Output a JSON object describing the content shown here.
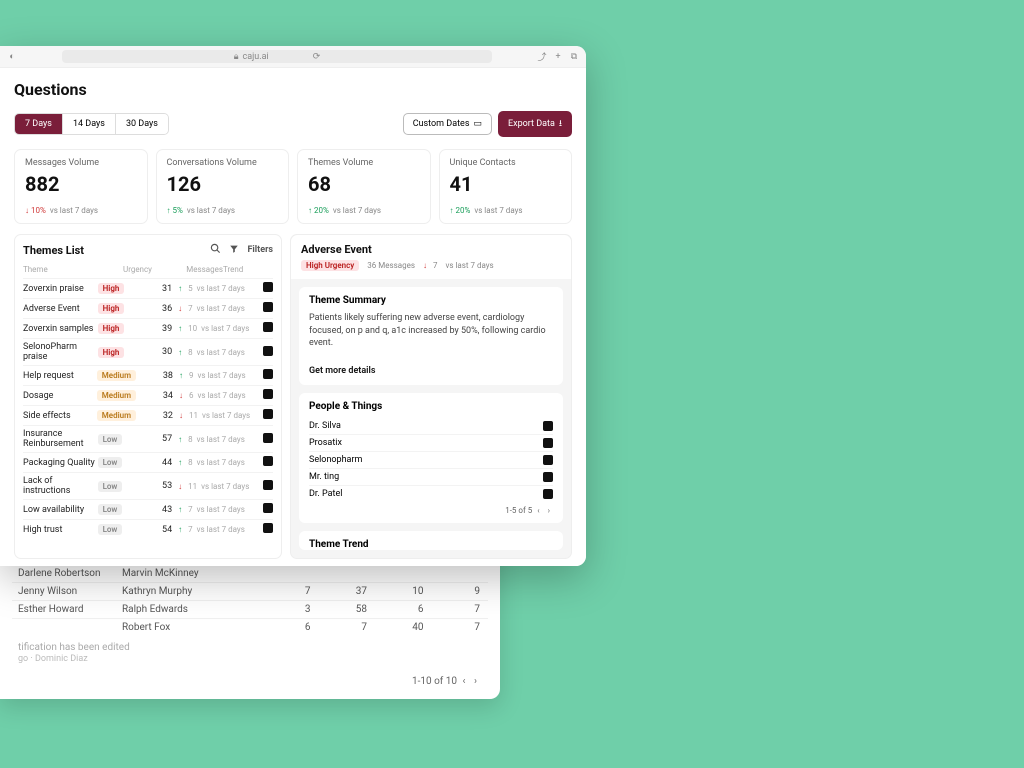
{
  "browser": {
    "url": "caju.ai"
  },
  "page": {
    "title": "Questions"
  },
  "range": {
    "d7": "7 Days",
    "d14": "14 Days",
    "d30": "30 Days"
  },
  "buttons": {
    "custom": "Custom Dates",
    "export": "Export Data"
  },
  "metrics": [
    {
      "label": "Messages Volume",
      "value": "882",
      "delta": "10%",
      "dir": "dn",
      "cmp": "vs last 7 days"
    },
    {
      "label": "Conversations Volume",
      "value": "126",
      "delta": "5%",
      "dir": "up",
      "cmp": "vs last 7 days"
    },
    {
      "label": "Themes Volume",
      "value": "68",
      "delta": "20%",
      "dir": "up",
      "cmp": "vs last 7 days"
    },
    {
      "label": "Unique Contacts",
      "value": "41",
      "delta": "20%",
      "dir": "up",
      "cmp": "vs last 7 days"
    }
  ],
  "themes": {
    "title": "Themes List",
    "filters": "Filters",
    "head": {
      "c1": "Theme",
      "c2": "Urgency",
      "c3": "Messages",
      "c4": "Trend"
    },
    "rows": [
      {
        "name": "Zoverxin praise",
        "urg": "High",
        "u": "high",
        "msgs": "31",
        "td": "5",
        "tdir": "up"
      },
      {
        "name": "Adverse Event",
        "urg": "High",
        "u": "high",
        "msgs": "36",
        "td": "7",
        "tdir": "dn"
      },
      {
        "name": "Zoverxin samples",
        "urg": "High",
        "u": "high",
        "msgs": "39",
        "td": "10",
        "tdir": "up"
      },
      {
        "name": "SelonoPharm praise",
        "urg": "High",
        "u": "high",
        "msgs": "30",
        "td": "8",
        "tdir": "up"
      },
      {
        "name": "Help request",
        "urg": "Medium",
        "u": "med",
        "msgs": "38",
        "td": "9",
        "tdir": "up"
      },
      {
        "name": "Dosage",
        "urg": "Medium",
        "u": "med",
        "msgs": "34",
        "td": "6",
        "tdir": "dn"
      },
      {
        "name": "Side effects",
        "urg": "Medium",
        "u": "med",
        "msgs": "32",
        "td": "11",
        "tdir": "dn"
      },
      {
        "name": "Insurance Reinbursement",
        "urg": "Low",
        "u": "low",
        "msgs": "57",
        "td": "8",
        "tdir": "up"
      },
      {
        "name": "Packaging Quality",
        "urg": "Low",
        "u": "low",
        "msgs": "44",
        "td": "8",
        "tdir": "up"
      },
      {
        "name": "Lack of instructions",
        "urg": "Low",
        "u": "low",
        "msgs": "53",
        "td": "11",
        "tdir": "dn"
      },
      {
        "name": "Low availability",
        "urg": "Low",
        "u": "low",
        "msgs": "43",
        "td": "7",
        "tdir": "up"
      },
      {
        "name": "High trust",
        "urg": "Low",
        "u": "low",
        "msgs": "54",
        "td": "7",
        "tdir": "up"
      }
    ],
    "cmp": "vs last 7 days"
  },
  "detail": {
    "title": "Adverse Event",
    "urgency": "High Urgency",
    "msgs": "36 Messages",
    "td": "7",
    "tdir": "dn",
    "cmp": "vs last 7 days",
    "summary": {
      "title": "Theme Summary",
      "text": "Patients likely suffering new adverse event, cardiology focused, on p and q, a1c increased by 50%, following cardio event.",
      "more": "Get more details"
    },
    "people": {
      "title": "People & Things",
      "items": [
        "Dr. Silva",
        "Prosatix",
        "Selonopharm",
        "Mr. ting",
        "Dr. Patel"
      ],
      "pager": "1-5 of 5"
    },
    "trend": {
      "title": "Theme Trend"
    }
  },
  "back": {
    "rows": [
      {
        "c1": "Darlene Robertson",
        "c2": "Marvin McKinney",
        "n": [
          "",
          "",
          "",
          ""
        ]
      },
      {
        "c1": "Jenny Wilson",
        "c2": "Kathryn Murphy",
        "n": [
          "7",
          "37",
          "10",
          "9"
        ]
      },
      {
        "c1": "Esther Howard",
        "c2": "Ralph Edwards",
        "n": [
          "3",
          "58",
          "6",
          "7"
        ]
      },
      {
        "c1": "",
        "c2": "Robert Fox",
        "n": [
          "6",
          "7",
          "40",
          "7"
        ]
      }
    ],
    "notif": "tification has been edited",
    "notif2": "go  ·  Dominic Diaz",
    "pager": "1-10 of 10"
  }
}
